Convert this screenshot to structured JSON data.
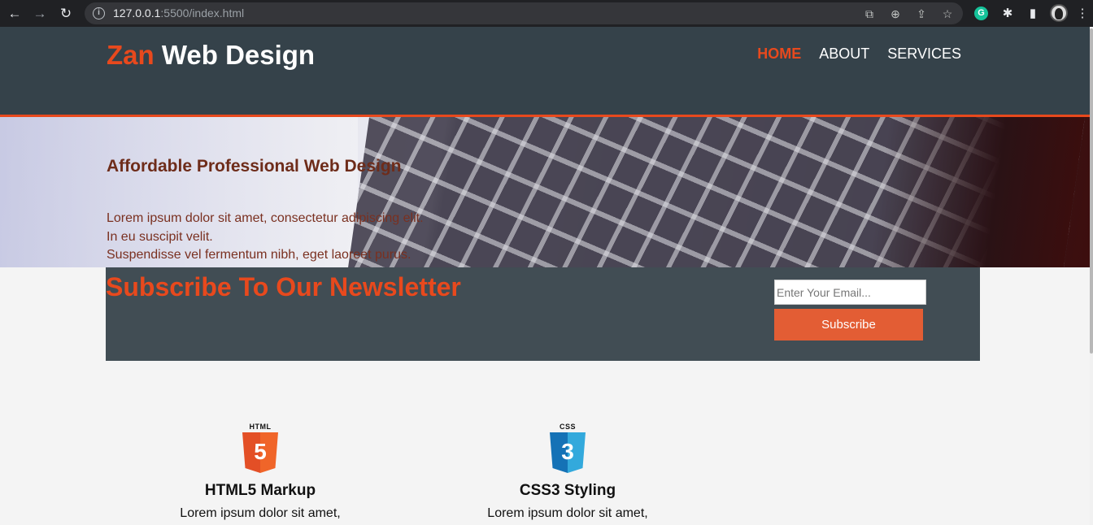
{
  "browser": {
    "url_host": "127.0.0.1",
    "url_rest": ":5500/index.html",
    "back_icon": "←",
    "forward_icon": "→",
    "reload_icon": "↻"
  },
  "header": {
    "logo_highlight": "Zan",
    "logo_rest": " Web Design",
    "nav": [
      {
        "label": "Home"
      },
      {
        "label": "About"
      },
      {
        "label": "Services"
      }
    ]
  },
  "showcase": {
    "title": "Affordable Professional Web Design",
    "lines": [
      "Lorem ipsum dolor sit amet, consectetur adipiscing elit.",
      "In eu suscipit velit.",
      "Suspendisse vel fermentum nibh, eget laoreet purus."
    ]
  },
  "newsletter": {
    "title": "Subscribe To Our Newsletter",
    "email_placeholder": "Enter Your Email...",
    "button_label": "Subscribe"
  },
  "boxes": [
    {
      "badge_tag": "HTML",
      "badge_number": "5",
      "title": "HTML5 Markup",
      "text": "Lorem ipsum dolor sit amet,"
    },
    {
      "badge_tag": "CSS",
      "badge_number": "3",
      "title": "CSS3 Styling",
      "text": "Lorem ipsum dolor sit amet,"
    }
  ],
  "colors": {
    "accent": "#e8491d",
    "header_bg": "#35424a",
    "newsletter_bg": "#414d54",
    "button_bg": "#e35d34"
  }
}
